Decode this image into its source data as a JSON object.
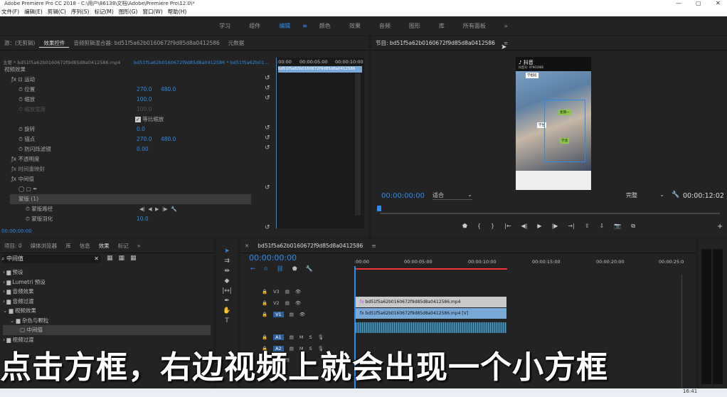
{
  "titlebar": {
    "text": "Adobe Premiere Pro CC 2018 - C:\\用户\\86138\\文档\\Adobe\\Premiere Pro\\12.0\\*"
  },
  "menu": [
    "文件(F)",
    "编辑(E)",
    "剪辑(C)",
    "序列(S)",
    "标记(M)",
    "图形(G)",
    "窗口(W)",
    "帮助(H)"
  ],
  "workspaces": [
    "学习",
    "组件",
    "编辑",
    "颜色",
    "效果",
    "音频",
    "图形",
    "库",
    "所有面板"
  ],
  "active_workspace": "编辑",
  "more_symbol": "»",
  "source_panel": {
    "tabs": [
      "源：(无剪辑)",
      "效果控件",
      "音频剪辑混合器: bd51f5a62b0160672f9d85d8a0412586",
      "元数据"
    ],
    "master_line": "主要 * bd51f5a62b0160672f9d85d8a0412586.mp4",
    "seq_line": "bd51f5a62b0160672f9d85d8a0412586 * bd51f5a62b01...",
    "section_video": "视频效果",
    "motion": "运动",
    "position": "位置",
    "position_x": "270.0",
    "position_y": "480.0",
    "scale": "缩放",
    "scale_v": "100.0",
    "scale_w": "缩放宽度",
    "scale_w_v": "100.0",
    "uniform": "等比缩放",
    "rotate": "旋转",
    "rotate_v": "0.0",
    "anchor": "锚点",
    "anchor_x": "270.0",
    "anchor_y": "480.0",
    "flicker": "防闪烁滤镜",
    "flicker_v": "0.00",
    "opacity": "不透明度",
    "timeremap": "时间重映射",
    "median": "中间值",
    "mask": "蒙版 (1)",
    "mask_path": "蒙版路径",
    "mask_feather": "蒙版羽化",
    "mask_feather_v": "10.0",
    "timecode": "00:00:00:00",
    "ruler": [
      ":00:00",
      "00:00:05:00",
      "00:00:10:00"
    ],
    "clip_label": "bd51f5a62b0160672f9d85d8a0412586"
  },
  "program": {
    "title": "节目: bd51f5a62b0160672f9d85d8a0412586",
    "timecode": "00:00:00:00",
    "fit": "适合",
    "quality": "完整",
    "duration": "00:00:12:02",
    "app": "抖音",
    "app_sub": "抖音号: 47661666",
    "tags": [
      "学姐班",
      "星期一",
      "学生",
      "学渣"
    ]
  },
  "project_panel": {
    "tabs": [
      "项目: 0",
      "媒体浏览器",
      "库",
      "信息",
      "效果",
      "标记"
    ],
    "search": "中间值",
    "tree": [
      "预设",
      "Lumetri 预设",
      "音频效果",
      "音频过渡",
      "视频效果",
      "杂色与颗粒",
      "中间值",
      "视频过渡"
    ]
  },
  "timeline": {
    "tab": "bd51f5a62b0160672f9d85d8a0412586",
    "timecode": "00:00:00:00",
    "ruler": [
      ":00:00",
      "00:00:05:00",
      "00:00:10:00",
      "00:00:15:00",
      "00:00:20:00",
      "00:00:25:0"
    ],
    "tracks": [
      "V3",
      "V2",
      "V1",
      "A1",
      "A2",
      "A3"
    ],
    "clip_v2": "bd51f5a62b0160672f9d85d8a0412586.mp4",
    "clip_v1": "bd51f5a62b0160672f9d85d8a0412586.mp4 [V]"
  },
  "subtitle": "点击方框，右边视频上就会出现一个小方框",
  "clock": "16:41",
  "colors": {
    "accent": "#2d8ceb",
    "clip_v2": "#c9c9c9",
    "clip_v1": "#7aa9d8",
    "audio": "#2d5f7d"
  }
}
